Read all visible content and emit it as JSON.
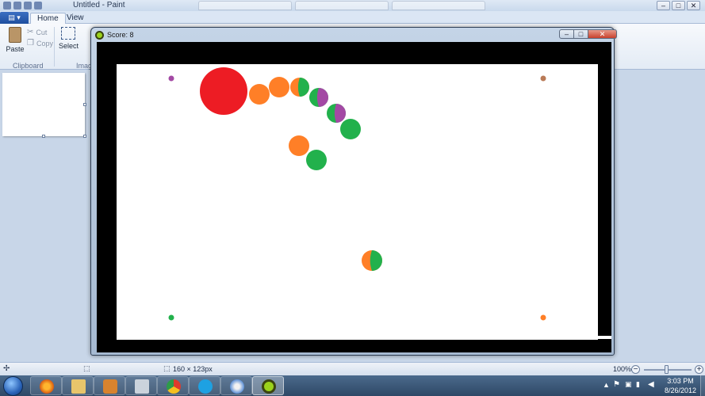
{
  "paint": {
    "window_title": "Untitled - Paint",
    "menu_button_label": "▤ ▾",
    "tabs": [
      {
        "label": "Home",
        "active": true
      },
      {
        "label": "View",
        "active": false
      }
    ],
    "clipboard": {
      "paste_label": "Paste",
      "cut_label": "Cut",
      "copy_label": "Copy",
      "group_label": "Clipboard"
    },
    "image": {
      "select_label": "Select",
      "group_label": "Imag"
    },
    "palette_colors": [
      "#000000",
      "#7f7f7f",
      "#880015",
      "#ed1c24",
      "#ff7f27",
      "#fff200",
      "#22b14c",
      "#00a2e8",
      "#3f48cc",
      "#a349a4",
      "#ffffff",
      "#c3c3c3"
    ],
    "window_controls": {
      "minimize": "–",
      "maximize": "□",
      "close": "✕"
    },
    "status": {
      "canvas_size": "160 × 123px",
      "zoom": "100%",
      "zoom_percent": 100,
      "zoom_out": "−",
      "zoom_in": "+"
    }
  },
  "game": {
    "title": "Score: 8",
    "score": 8,
    "controls": {
      "minimize": "–",
      "maximize": "□",
      "close": "✕"
    },
    "colors": {
      "red": "#ed1c24",
      "orange": "#ff7f27",
      "green": "#22b14c",
      "purple": "#a349a4",
      "brown": "#b97a57"
    },
    "corner_dots": [
      {
        "corner": "top-left",
        "color": "purple"
      },
      {
        "corner": "top-right",
        "color": "brown"
      },
      {
        "corner": "bottom-left",
        "color": "green"
      },
      {
        "corner": "bottom-right",
        "color": "orange"
      }
    ],
    "balls": [
      {
        "kind": "player",
        "color": "red"
      },
      {
        "kind": "chain",
        "color": "orange"
      },
      {
        "kind": "chain",
        "color": "orange"
      },
      {
        "kind": "chain",
        "color": "orange",
        "overlay": "green"
      },
      {
        "kind": "chain",
        "color": "green",
        "overlay": "purple"
      },
      {
        "kind": "chain",
        "color": "green",
        "overlay": "purple"
      },
      {
        "kind": "chain",
        "color": "green"
      },
      {
        "kind": "loose",
        "color": "orange"
      },
      {
        "kind": "loose",
        "color": "green"
      },
      {
        "kind": "loose",
        "color": "orange",
        "overlay": "green"
      }
    ]
  },
  "taskbar": {
    "apps": [
      "start-icon",
      "firefox-icon",
      "explorer-icon",
      "media-player-icon",
      "photos-icon",
      "chrome-icon",
      "skype-icon",
      "paint-icon",
      "game-icon"
    ],
    "active_app": "game",
    "clock_time": "3:03 PM",
    "clock_date": "8/26/2012"
  }
}
